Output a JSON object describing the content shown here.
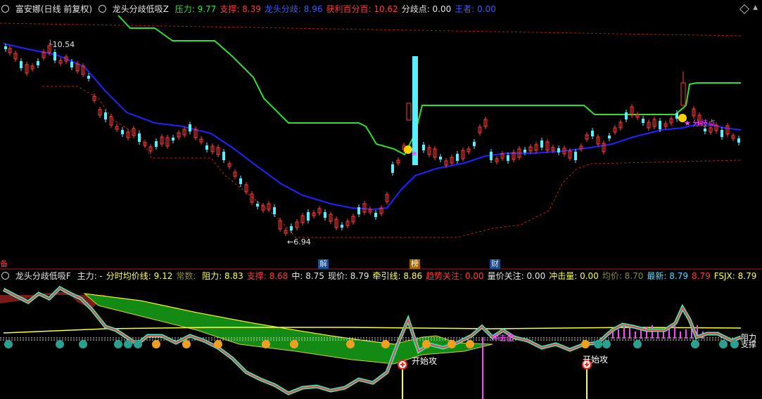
{
  "main_header": {
    "stock_title": "富安娜(日线 前复权)",
    "indicator_name": "龙头分歧低吸Z",
    "fields": [
      {
        "label": "压力: ",
        "value": "9.77",
        "color": "#35e03a"
      },
      {
        "label": "支撑: ",
        "value": "8.39",
        "color": "#ff3b3b"
      },
      {
        "label": "龙头分歧: ",
        "value": "8.96",
        "color": "#3f5bff"
      },
      {
        "label": "获利百分百: ",
        "value": "10.62",
        "color": "#ff3b3b"
      },
      {
        "label": "分歧点: ",
        "value": "0.00",
        "color": "#e6e6e6"
      },
      {
        "label": "王者: ",
        "value": "0.00",
        "color": "#3f5bff"
      }
    ]
  },
  "price_labels": {
    "high": "10.54",
    "low": "6.94",
    "low_arrow": "←"
  },
  "event_markers": [
    "解",
    "榜",
    "财"
  ],
  "left_marker": "备",
  "sub_header": {
    "indicator_name": "龙头分歧低吸F",
    "fields": [
      {
        "label": "主力: ",
        "value": "-",
        "color": "#e6e6e6"
      },
      {
        "label": "分时均价线: ",
        "value": "9.12",
        "color": "#ffff4a"
      },
      {
        "label": "常数: ",
        "value": "",
        "color": "#8c8c3c"
      },
      {
        "label": "阻力: ",
        "value": "8.83",
        "color": "#ffff4a"
      },
      {
        "label": "支撑: ",
        "value": "8.68",
        "color": "#ff3b3b"
      },
      {
        "label": "中: ",
        "value": "8.75",
        "color": "#e6e6e6"
      },
      {
        "label": "现价: ",
        "value": "8.79",
        "color": "#e6e6e6"
      },
      {
        "label": "牵引线: ",
        "value": "8.86",
        "color": "#ffff4a"
      },
      {
        "label": "趋势关注: ",
        "value": "0.00",
        "color": "#ff3b3b"
      },
      {
        "label": "量价关注: ",
        "value": "0.00",
        "color": "#e6e6e6"
      },
      {
        "label": "冲击量: ",
        "value": "0.00",
        "color": "#ffff4a"
      },
      {
        "label": "均价: ",
        "value": "8.70",
        "color": "#8c8c3c"
      },
      {
        "label": "最新: ",
        "value": "8.79",
        "color": "#58d8ff"
      },
      {
        "label": "",
        "value": "8.79",
        "color": "#ff3b3b"
      },
      {
        "label": "FSJX: ",
        "value": "8.79",
        "color": "#ffff4a"
      }
    ]
  },
  "chart_text": {
    "start_attack_1": "开始攻",
    "start_attack_2": "开始攻",
    "impact_volume": "冲击量",
    "resistance": "阻力",
    "support": "支撑",
    "divergence_label": "分歧点"
  },
  "colors": {
    "up": "#ff3b3b",
    "down": "#58f0ff",
    "pressure": "#35e03a",
    "divergence_line": "#2626ff",
    "support_dash": "#c02020"
  }
}
